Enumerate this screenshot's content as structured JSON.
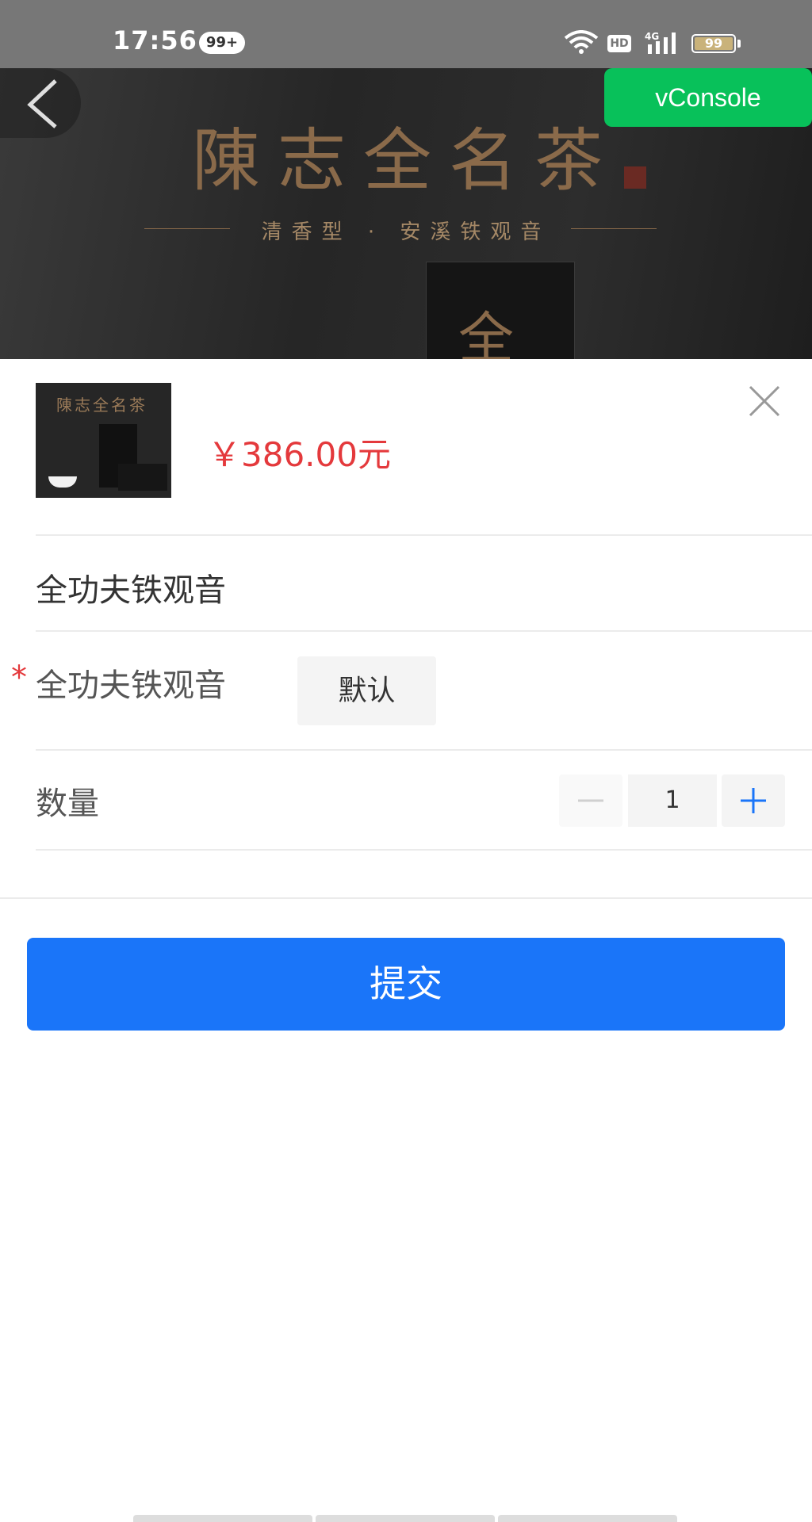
{
  "status_bar": {
    "time": "17:56",
    "notification_count": "99+",
    "hd_label": "HD",
    "network_label": "4G",
    "battery_level": "99"
  },
  "hero": {
    "brand_text": "陳志全名茶",
    "subtitle": "清香型 · 安溪铁观音",
    "box_mark": "全"
  },
  "vconsole": {
    "label": "vConsole"
  },
  "product": {
    "thumb_brand": "陳志全名茶",
    "price": "￥386.00元",
    "name": "全功夫铁观音"
  },
  "spec": {
    "required_mark": "*",
    "label": "全功夫铁观音",
    "options": [
      "默认"
    ],
    "selected": "默认"
  },
  "quantity": {
    "label": "数量",
    "value": "1"
  },
  "actions": {
    "submit_label": "提交"
  },
  "colors": {
    "primary": "#1a75f9",
    "price": "#e4393c",
    "vconsole": "#08c15a"
  }
}
